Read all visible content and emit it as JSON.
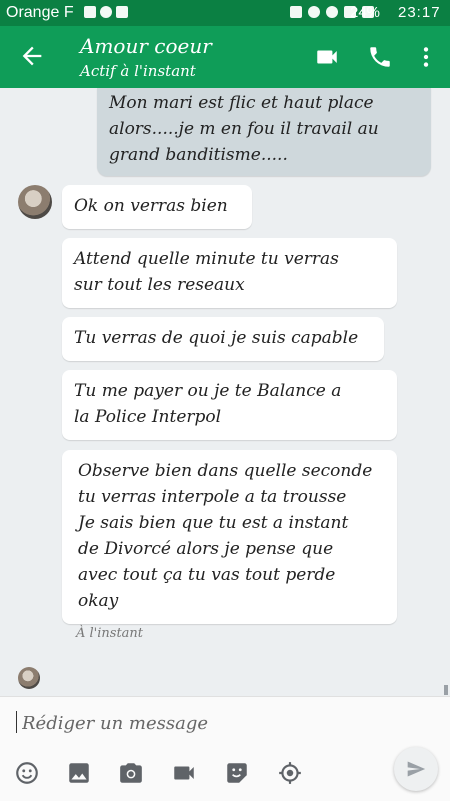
{
  "status_bar": {
    "carrier": "Orange F",
    "battery_percent": "24%",
    "time": "23:17"
  },
  "header": {
    "title": "Amour coeur",
    "subtitle": "Actif à l'instant"
  },
  "messages": [
    {
      "direction": "out",
      "text": "Mon mari est flic et haut place\nalors.....je m en fou il travail au\ngrand banditisme....."
    },
    {
      "direction": "in",
      "text": "Ok  on verras  bien"
    },
    {
      "direction": "in",
      "text": "Attend  quelle minute tu verras\nsur  tout les reseaux"
    },
    {
      "direction": "in",
      "text": "Tu verras  de quoi  je suis  capable"
    },
    {
      "direction": "in",
      "text": "Tu  me payer  ou  je te  Balance  a\nla Police  Interpol"
    },
    {
      "direction": "in",
      "text": "Observe  bien dans  quelle  seconde\ntu verras  interpole a  ta  trousse\n Je sais bien  que tu est  a  instant\n de  Divorcé  alors je pense que\n avec tout  ça tu vas tout perde\n okay"
    }
  ],
  "last_timestamp": "À l'instant",
  "composer": {
    "placeholder": "Rédiger un message"
  },
  "toolbar_icons": [
    "emoji-icon",
    "gallery-icon",
    "camera-icon",
    "video-icon",
    "sticker-icon",
    "location-icon",
    "send-icon"
  ],
  "colors": {
    "status_bar": "#0b8043",
    "app_bar": "#0f9d58",
    "chat_background": "#eceff1",
    "outgoing_bubble": "#cfd8dc",
    "incoming_bubble": "#ffffff"
  }
}
